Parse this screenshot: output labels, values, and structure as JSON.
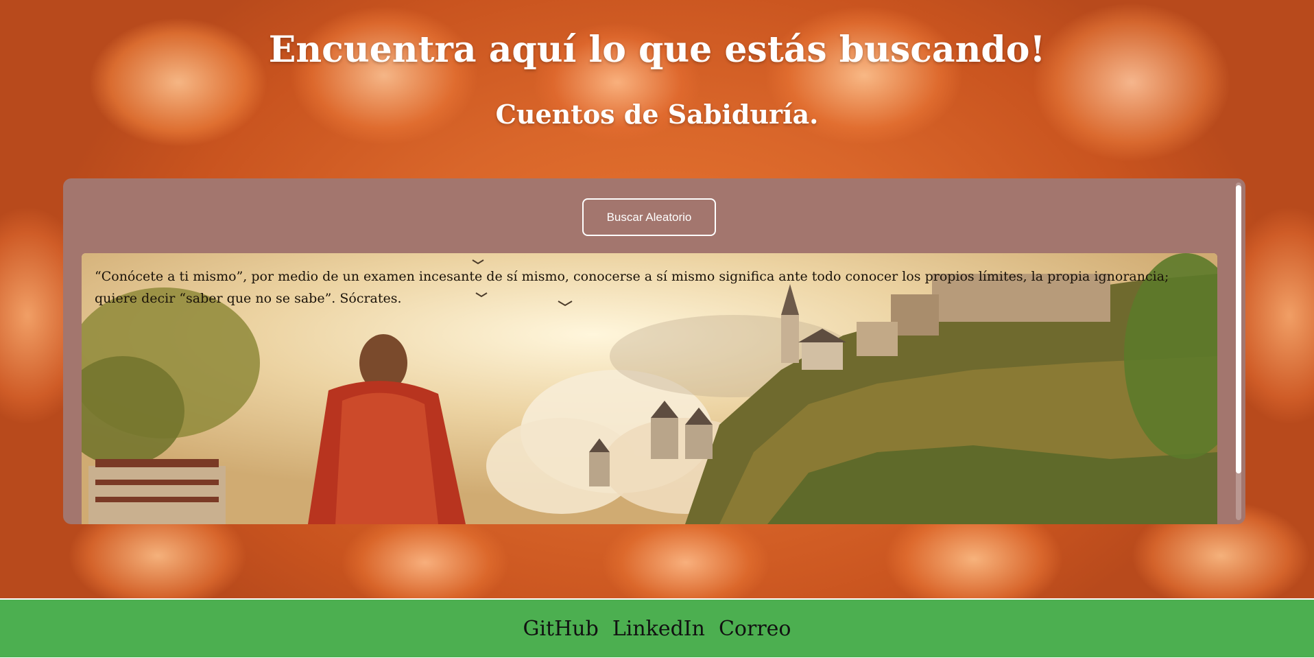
{
  "header": {
    "title": "Encuentra aquí lo que estás buscando!",
    "subtitle": "Cuentos de Sabiduría."
  },
  "panel": {
    "random_button_label": "Buscar Aleatorio",
    "quote": "“Conócete a ti mismo”, por medio de un examen incesante de sí mismo, conocerse a sí mismo significa ante todo conocer los propios límites, la propia ignorancia; quiere decir “saber que no se sabe”. Sócrates."
  },
  "footer": {
    "links": [
      "GitHub",
      "LinkedIn",
      "Correo"
    ]
  },
  "colors": {
    "panel_background": "#a3766e",
    "footer_background": "#4caf50",
    "header_text": "#ffffff",
    "background_accent": "#e8762f"
  },
  "icons": {
    "background": "orange-dahlia-petals-image",
    "scene": "monk-castle-landscape-image"
  }
}
